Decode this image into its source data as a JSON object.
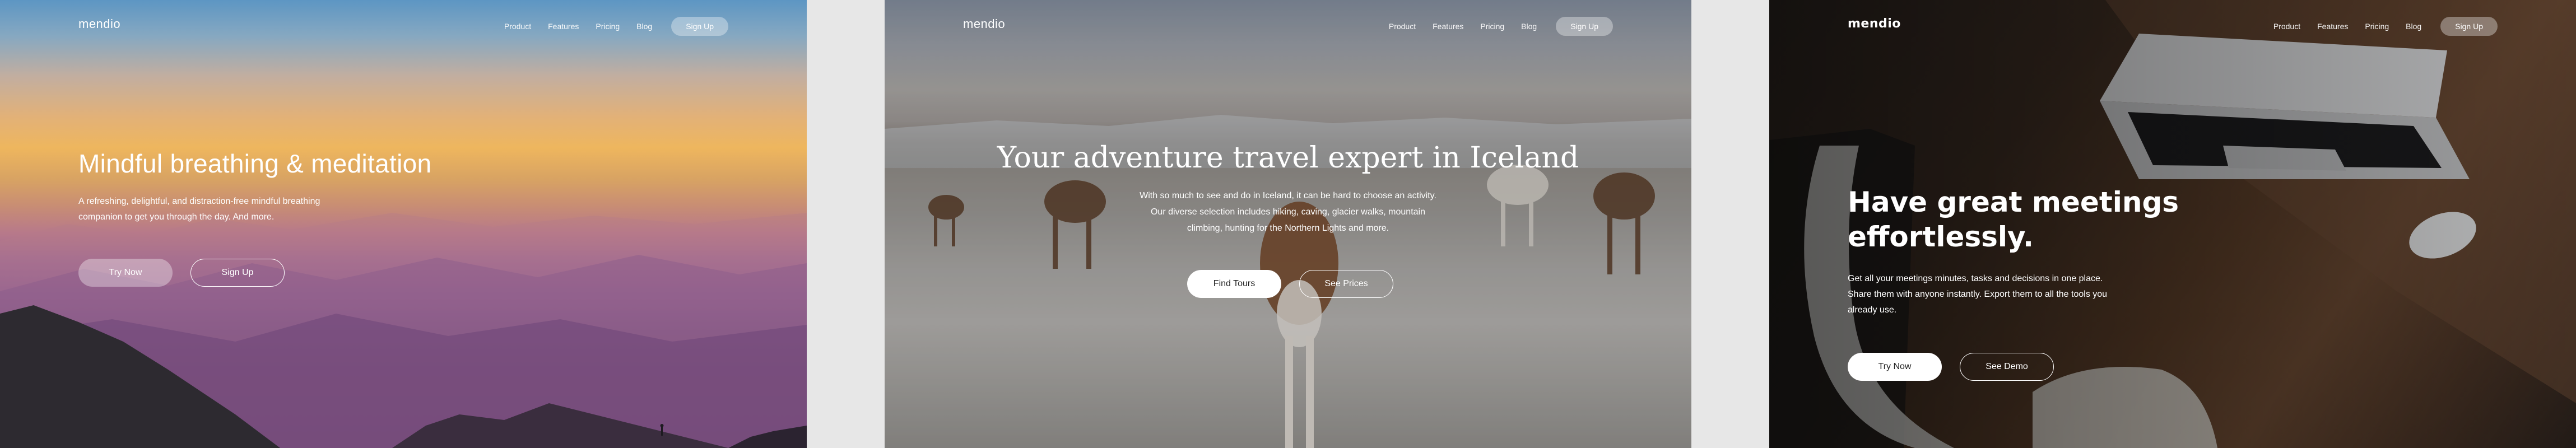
{
  "panel1": {
    "logo": "mendio",
    "nav": [
      "Product",
      "Features",
      "Pricing",
      "Blog"
    ],
    "nav_signup": "Sign Up",
    "title": "Mindful breathing & meditation",
    "description": "A refreshing, delightful, and distraction-free mindful breathing companion to get you through the day. And more.",
    "primary_button": "Try Now",
    "secondary_button": "Sign Up"
  },
  "panel2": {
    "logo": "mendio",
    "nav": [
      "Product",
      "Features",
      "Pricing",
      "Blog"
    ],
    "nav_signup": "Sign Up",
    "title": "Your adventure travel expert in Iceland",
    "description": "With so much to see and do in Iceland, it can be hard to choose an activity. Our diverse selection includes hiking, caving, glacier walks, mountain climbing, hunting for the Northern Lights and more.",
    "primary_button": "Find Tours",
    "secondary_button": "See Prices"
  },
  "panel3": {
    "logo": "mendio",
    "nav": [
      "Product",
      "Features",
      "Pricing",
      "Blog"
    ],
    "nav_signup": "Sign Up",
    "title": "Have great meetings effortlessly.",
    "description": "Get all your meetings minutes, tasks and decisions in one place. Share them with anyone instantly. Export them to all the tools you already use.",
    "primary_button": "Try Now",
    "secondary_button": "See Demo"
  }
}
